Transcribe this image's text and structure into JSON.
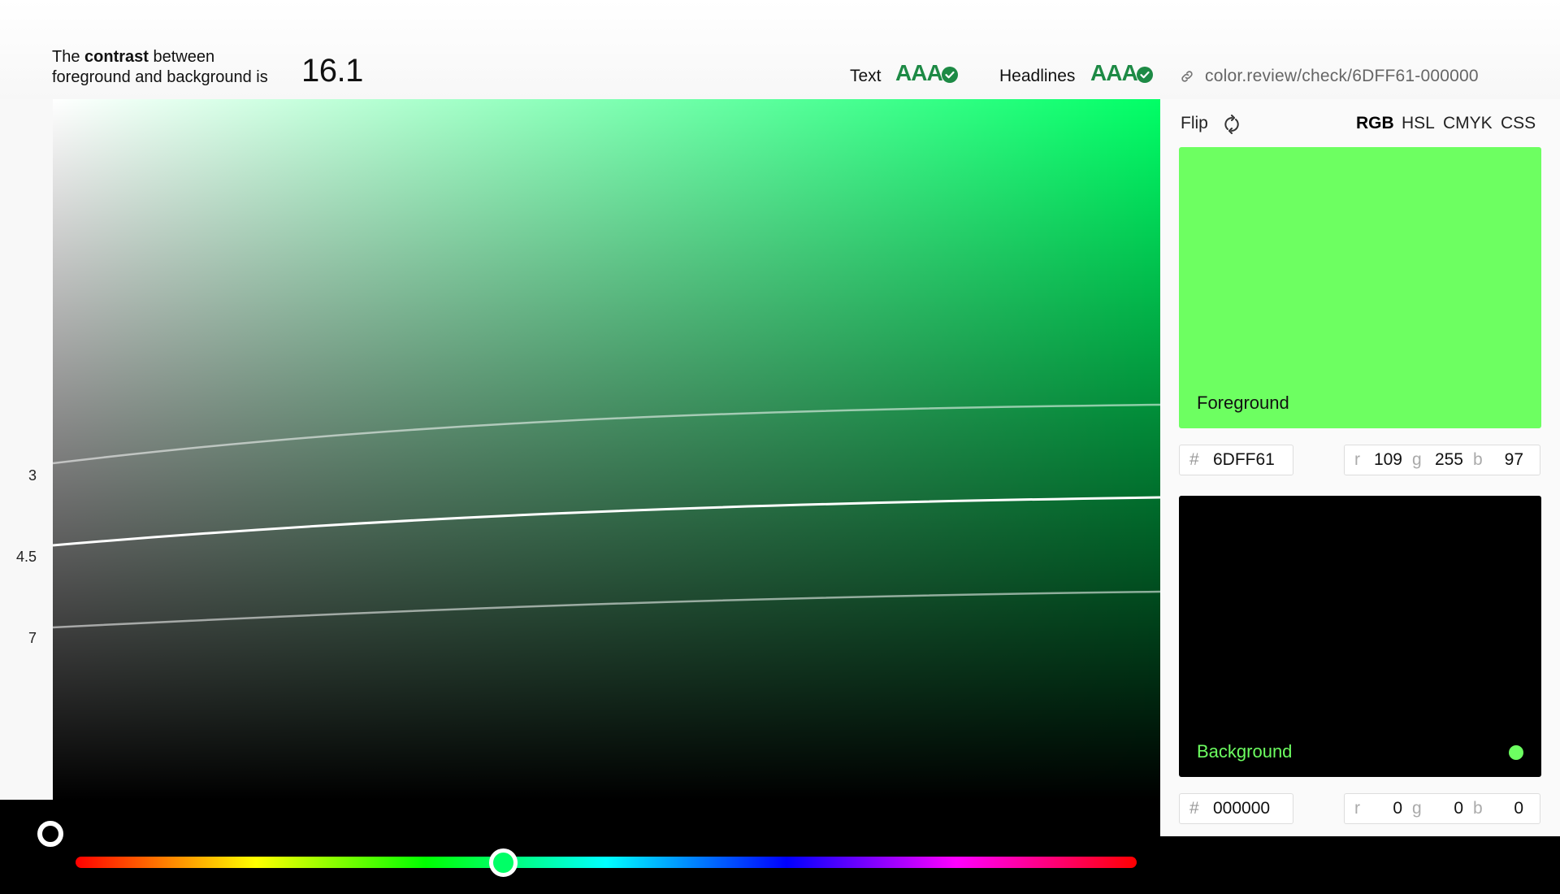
{
  "header": {
    "contrast_prefix": "The ",
    "contrast_bold": "contrast",
    "contrast_suffix": " between",
    "contrast_line2": "foreground and background is",
    "contrast_value": "16.1",
    "text_label": "Text",
    "text_rating": "AAA",
    "headlines_label": "Headlines",
    "headlines_rating": "AAA",
    "share_url": "color.review/check/6DFF61-000000"
  },
  "picker": {
    "ratio_labels": [
      "3",
      "4.5",
      "7"
    ],
    "hue_track_gradient": [
      "#ff0000",
      "#ffff00",
      "#00ff00",
      "#00ffff",
      "#0000ff",
      "#ff00ff",
      "#ff0000"
    ],
    "hue_value": 0.4,
    "hue_handle_color": "#00ff66",
    "selected_marker_color": "#000000",
    "area_top_right_color": "#00ff66"
  },
  "panel": {
    "flip_label": "Flip",
    "modes": [
      "RGB",
      "HSL",
      "CMYK",
      "CSS"
    ],
    "active_mode": "RGB",
    "foreground": {
      "label": "Foreground",
      "color": "#6DFF61",
      "hex_prefix": "#",
      "hex": "6DFF61",
      "r_label": "r",
      "r": "109",
      "g_label": "g",
      "g": "255",
      "b_label": "b",
      "b": "97"
    },
    "background": {
      "label": "Background",
      "color": "#000000",
      "label_color": "#6DFF61",
      "hex_prefix": "#",
      "hex": "000000",
      "r_label": "r",
      "r": "0",
      "g_label": "g",
      "g": "0",
      "b_label": "b",
      "b": "0",
      "active": true
    }
  },
  "colors": {
    "pass_green": "#1d8a45",
    "url_grey": "#666666"
  },
  "icons": [
    "check-circle-icon",
    "link-icon",
    "flip-icon"
  ]
}
